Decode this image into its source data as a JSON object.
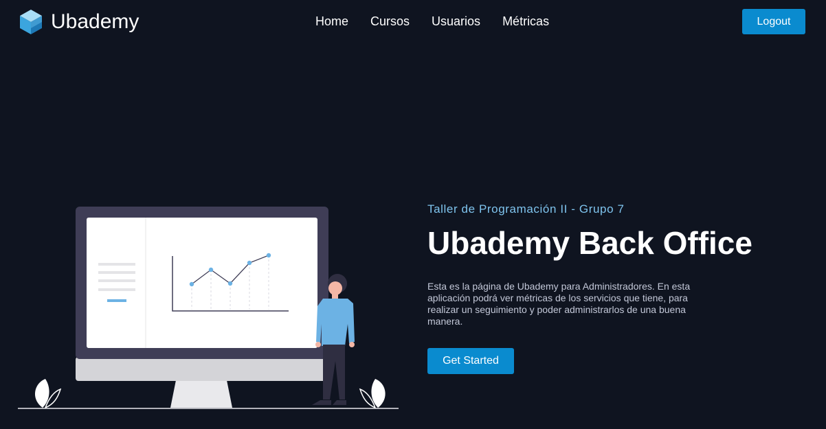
{
  "app": {
    "brand_name": "Ubademy"
  },
  "navbar": {
    "items": [
      {
        "label": "Home"
      },
      {
        "label": "Cursos"
      },
      {
        "label": "Usuarios"
      },
      {
        "label": "Métricas"
      }
    ],
    "logout_label": "Logout"
  },
  "hero": {
    "subtitle": "Taller de Programación II - Grupo 7",
    "title": "Ubademy Back Office",
    "description": "Esta es la página de Ubademy para Administradores. En esta aplicación podrá ver métricas de los servicios que tiene, para realizar un seguimiento y poder administrarlos de una buena manera.",
    "cta_label": "Get Started"
  },
  "colors": {
    "background": "#0f1420",
    "accent": "#0a8bcf",
    "subtitle": "#7fc4ee"
  },
  "icons": {
    "brand": "cube-logo-icon",
    "illustration": "presentation-chart-illustration"
  }
}
